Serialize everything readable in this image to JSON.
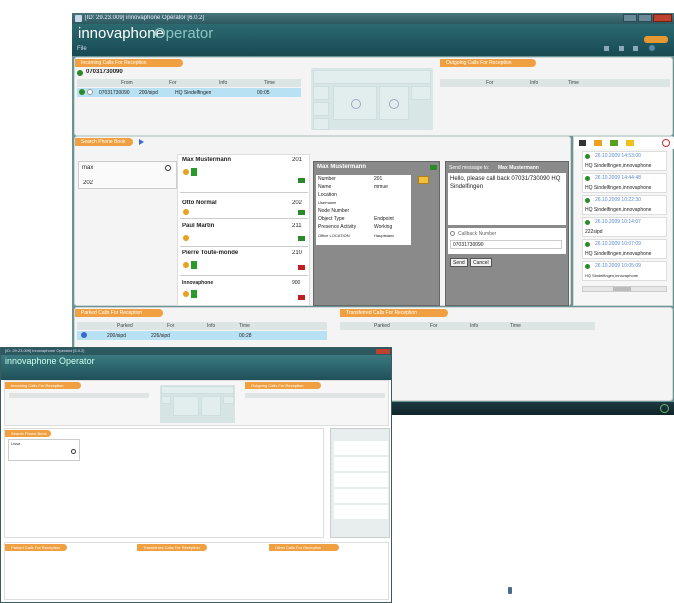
{
  "main": {
    "title_bar": "[ID: 29.23.009] innovaphone Operator [6.0.2]",
    "app_name": "innovaphone",
    "app_suffix": "Operator",
    "menu": "File",
    "incoming": {
      "header": "Incoming Calls For Reception",
      "number": "07031730090",
      "cols": [
        "From",
        "For",
        "Info",
        "Time"
      ],
      "row": [
        "07031730090",
        "200/sipd",
        "HQ Sindelfingen",
        "00:05"
      ]
    },
    "outgoing": {
      "header": "Outgoing Calls For Reception",
      "cols": [
        "For",
        "Info",
        "Time"
      ]
    },
    "search": {
      "header": "Search Phone Book",
      "value": "max",
      "result": "202"
    },
    "contacts": [
      {
        "name": "Max Mustermann",
        "ext": "201",
        "status_color": "#2a8a2a"
      },
      {
        "name": "Otto Normal",
        "ext": "202",
        "status_color": "#2a8a2a"
      },
      {
        "name": "Paul Martin",
        "ext": "211",
        "status_color": "#2a8a2a"
      },
      {
        "name": "Pierre Toute-monde",
        "ext": "210",
        "status_color": "#c02020"
      },
      {
        "name": "Innovaphone",
        "ext": "900",
        "status_color": "#c02020"
      }
    ],
    "details": {
      "title": "Max Mustermann",
      "rows": [
        {
          "k": "Number",
          "v": "201"
        },
        {
          "k": "Name",
          "v": "mmue"
        },
        {
          "k": "Location",
          "v": ""
        },
        {
          "k": "Username",
          "v": ""
        },
        {
          "k": "Node Number",
          "v": ""
        },
        {
          "k": "Object Type",
          "v": "Endpoint"
        },
        {
          "k": "Presence Activity",
          "v": "Working"
        },
        {
          "k": "Office LOCATION",
          "v": "Hauptstand"
        }
      ]
    },
    "message": {
      "title": "Send message to:",
      "recipient": "Max Mustermann",
      "body": "Hello, please call back 07031/730090 HQ Sindelfingen",
      "callback_label": "Callback Number",
      "callback_value": "07031730090",
      "send": "Send",
      "cancel": "Cancel"
    },
    "history": [
      {
        "date": "26.10.2009 14:53:00",
        "text": "HQ Sindelfingen,innovaphone"
      },
      {
        "date": "26.10.2009 14:44:48",
        "text": "HQ Sindelfingen,innovaphone"
      },
      {
        "date": "26.10.2009 10:22:30",
        "text": "HQ Sindelfingen,innovaphone"
      },
      {
        "date": "26.10.2009 10:14:07",
        "text": "222sipd"
      },
      {
        "date": "26.10.2009 10:07:09",
        "text": "HQ Sindelfingen,innovaphone"
      },
      {
        "date": "26.10.2009 10:05:09",
        "text": "HQ Sindelfingen,innovaphone"
      }
    ],
    "parked": {
      "header": "Parked Calls For Reception",
      "cols": [
        "Parked",
        "For",
        "Info",
        "Time"
      ],
      "row": [
        "200/sipd",
        "226/sipd",
        "",
        "00:28"
      ]
    },
    "transferred": {
      "header": "Transferred Calls For Reception",
      "cols": [
        "Parked",
        "For",
        "Info",
        "Time"
      ]
    }
  },
  "small": {
    "title_bar": "[ID: 29.23.009] innovaphone Operator [6.0.2]",
    "app_name": "innovaphone Operator",
    "search_value": "Lissa",
    "sections": [
      "Incoming Calls For Reception",
      "Outgoing Calls For Reception",
      "Search Phone Book",
      "Parked Calls For Reception",
      "Transferred Calls For Reception",
      "Other Calls For Reception"
    ]
  },
  "colors": {
    "titlebar": "#2c5860",
    "app_bg": "#6a9496",
    "accent": "#f0a040",
    "selected_row": "#b8e2f4"
  }
}
